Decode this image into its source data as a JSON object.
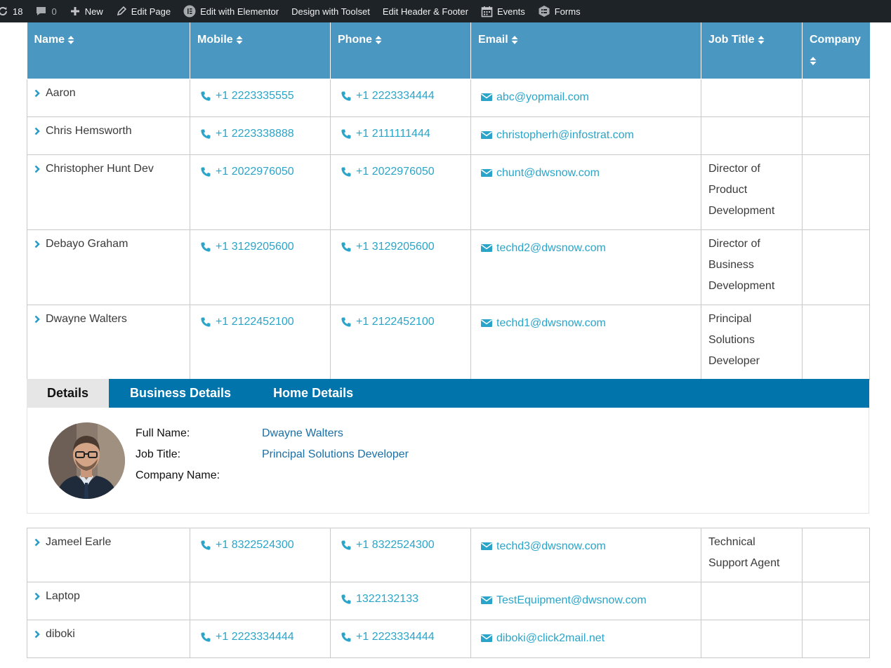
{
  "admin_bar": {
    "updates_count": "18",
    "comments_count": "0",
    "new_label": "New",
    "edit_page_label": "Edit Page",
    "elementor_label": "Edit with Elementor",
    "toolset_label": "Design with Toolset",
    "header_footer_label": "Edit Header & Footer",
    "events_label": "Events",
    "forms_label": "Forms"
  },
  "table": {
    "headers": [
      "Name",
      "Mobile",
      "Phone",
      "Email",
      "Job Title",
      "Company"
    ],
    "rows": [
      {
        "name": "Aaron",
        "mobile": "+1 2223335555",
        "phone": "+1 2223334444",
        "email": "abc@yopmail.com",
        "job_title": [
          "",
          "",
          ""
        ],
        "company": ""
      },
      {
        "name": "Chris Hemsworth",
        "mobile": "+1 2223338888",
        "phone": "+1 2111111444",
        "email": "christopherh@infostrat.com",
        "job_title": [
          "",
          "",
          ""
        ],
        "company": ""
      },
      {
        "name": "Christopher Hunt Dev",
        "mobile": "+1 2022976050",
        "phone": "+1 2022976050",
        "email": "chunt@dwsnow.com",
        "job_title": [
          "Director of",
          "Product",
          "Development"
        ],
        "company": ""
      },
      {
        "name": "Debayo Graham",
        "mobile": "+1 3129205600",
        "phone": "+1 3129205600",
        "email": "techd2@dwsnow.com",
        "job_title": [
          "Director of",
          "Business",
          "Development"
        ],
        "company": ""
      },
      {
        "name": "Dwayne Walters",
        "mobile": "+1 2122452100",
        "phone": "+1 2122452100",
        "email": "techd1@dwsnow.com",
        "job_title": [
          "Principal",
          "Solutions",
          "Developer"
        ],
        "company": ""
      }
    ],
    "rows_after": [
      {
        "name": "Jameel Earle",
        "mobile": "+1 8322524300",
        "phone": "+1 8322524300",
        "email": "techd3@dwsnow.com",
        "job_title": [
          "Technical",
          "Support Agent"
        ],
        "company": ""
      },
      {
        "name": "Laptop",
        "mobile": "",
        "phone": "1322132133",
        "email": "TestEquipment@dwsnow.com",
        "job_title": [
          ""
        ],
        "company": ""
      },
      {
        "name": "diboki",
        "mobile": "+1 2223334444",
        "phone": "+1 2223334444",
        "email": "diboki@click2mail.net",
        "job_title": [
          ""
        ],
        "company": ""
      }
    ]
  },
  "details": {
    "tabs": [
      "Details",
      "Business Details",
      "Home Details"
    ],
    "active_tab": "Details",
    "labels": {
      "full_name": "Full Name:",
      "job_title": "Job Title:",
      "company_name": "Company Name:"
    },
    "values": {
      "full_name": "Dwayne Walters",
      "job_title": "Principal Solutions Developer",
      "company_name": ""
    }
  },
  "colors": {
    "admin_bar": "#1d2327",
    "header_bg": "#4a97c1",
    "tab_bar": "#0074ab",
    "link": "#2aa5c9"
  },
  "icons": {
    "expand": "chevron-right-icon",
    "mobile": "phone-icon",
    "phone": "phone-icon",
    "email": "envelope-icon",
    "sort": "sort-icon"
  }
}
